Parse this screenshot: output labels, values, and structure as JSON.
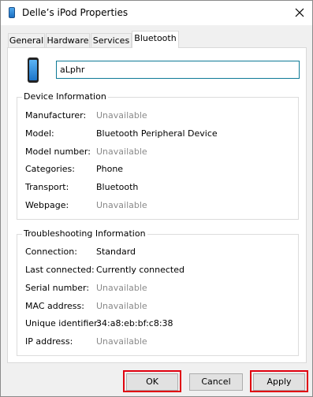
{
  "window": {
    "title": "Delle’s iPod Properties"
  },
  "tabs": [
    "General",
    "Hardware",
    "Services",
    "Bluetooth"
  ],
  "device": {
    "name": "aLphr"
  },
  "device_info": {
    "heading": "Device Information",
    "rows": [
      {
        "label": "Manufacturer:",
        "value": "Unavailable"
      },
      {
        "label": "Model:",
        "value": "Bluetooth Peripheral Device"
      },
      {
        "label": "Model number:",
        "value": "Unavailable"
      },
      {
        "label": "Categories:",
        "value": "Phone"
      },
      {
        "label": "Transport:",
        "value": "Bluetooth"
      },
      {
        "label": "Webpage:",
        "value": "Unavailable"
      }
    ]
  },
  "troubleshooting": {
    "heading": "Troubleshooting Information",
    "rows": [
      {
        "label": "Connection:",
        "value": "Standard"
      },
      {
        "label": "Last connected:",
        "value": "Currently connected"
      },
      {
        "label": "Serial number:",
        "value": "Unavailable"
      },
      {
        "label": "MAC address:",
        "value": "Unavailable"
      },
      {
        "label": "Unique identifier:",
        "value": "34:a8:eb:bf:c8:38"
      },
      {
        "label": "IP address:",
        "value": "Unavailable"
      }
    ]
  },
  "buttons": {
    "ok": "OK",
    "cancel": "Cancel",
    "apply": "Apply"
  },
  "colors": {
    "highlight": "#e0000f",
    "unavailable_text": "#8a8a8a",
    "textbox_border": "#0e7a96"
  },
  "icons": {
    "title": "ipod-device-icon",
    "close": "close-icon",
    "device": "phone-device-icon"
  }
}
